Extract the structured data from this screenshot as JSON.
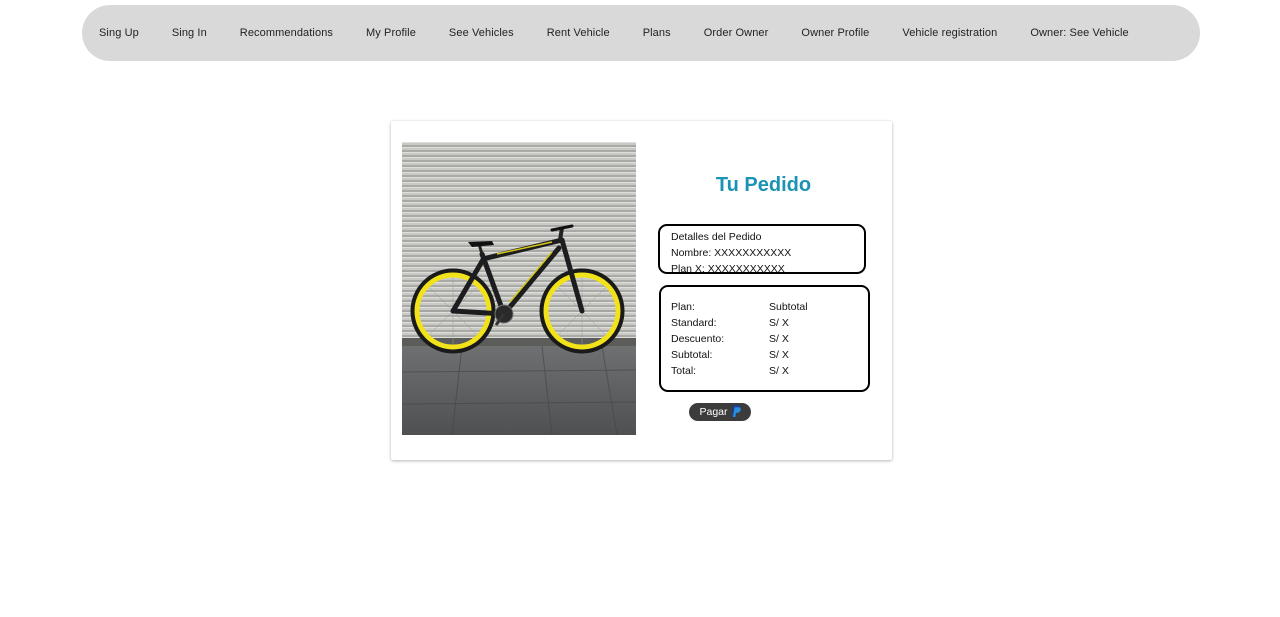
{
  "nav": {
    "items": [
      {
        "label": "Sing Up"
      },
      {
        "label": "Sing In"
      },
      {
        "label": "Recommendations"
      },
      {
        "label": "My Profile"
      },
      {
        "label": "See Vehicles"
      },
      {
        "label": "Rent Vehicle"
      },
      {
        "label": "Plans"
      },
      {
        "label": "Order Owner"
      },
      {
        "label": "Owner Profile"
      },
      {
        "label": "Vehicle registration"
      },
      {
        "label": "Owner: See Vehicle"
      }
    ]
  },
  "order": {
    "title": "Tu Pedido",
    "details": {
      "heading": "Detalles del Pedido",
      "name_line": "Nombre: XXXXXXXXXXX",
      "plan_line": "Plan X: XXXXXXXXXXX"
    },
    "summary": {
      "header": {
        "label": "Plan:",
        "value": "Subtotal"
      },
      "rows": [
        {
          "label": "Standard:",
          "value": "S/ X"
        },
        {
          "label": "Descuento:",
          "value": "S/ X"
        },
        {
          "label": "Subtotal:",
          "value": "S/ X"
        },
        {
          "label": "Total:",
          "value": "S/ X"
        }
      ]
    },
    "pay_label": "Pagar",
    "pay_icon": "paypal-icon"
  },
  "colors": {
    "navbar_bg": "#d9d9d9",
    "title": "#1a93b4",
    "pay_button_bg": "#3c3c3c",
    "paypal_dark": "#1d3e8a",
    "paypal_light": "#2a8ee3",
    "bike_rim": "#f2e21a"
  }
}
